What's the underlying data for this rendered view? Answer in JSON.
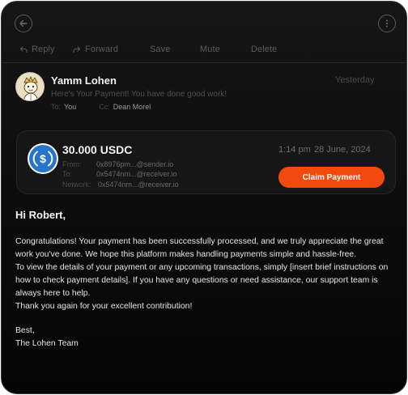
{
  "toolbar": {
    "reply": "Reply",
    "forward": "Forward",
    "save": "Save",
    "mute": "Mute",
    "delete": "Delete"
  },
  "message": {
    "sender": "Yamm Lohen",
    "subject": "Here's Your Payment! You have done good work!",
    "date": "Yesterday",
    "to_label": "To:",
    "to": "You",
    "cc_label": "Cc:",
    "cc": "Dean Morel"
  },
  "payment": {
    "amount": "30.000 USDC",
    "from_label": "From:",
    "from": "0x8976pm...@sender.io",
    "to_label": "To:",
    "to": "0x5474nm...@receiver.io",
    "network_label": "Network:",
    "network": "0x5474nm...@receiver.io",
    "time": "1:14 pm",
    "date": "28 June, 2024",
    "claim_label": "Claim Payment",
    "accent": "#f24a0d",
    "usdc_color": "#2775ca"
  },
  "body": {
    "greeting": "Hi Robert,",
    "lines": [
      "Congratulations! Your payment has been successfully processed, and we truly appreciate the great",
      "work you've done. We hope this platform makes handling payments simple and hassle-free.",
      "To view the details of your payment or any upcoming transactions, simply [insert brief instructions on",
      "how to check payment details]. If you have any questions or need assistance, our support team is",
      "always here to help.",
      "Thank you again for your excellent contribution!"
    ],
    "closing": "Best,",
    "signature": "The Lohen Team"
  },
  "icons": {
    "back": "arrow-left-icon",
    "more": "more-vertical-icon",
    "reply": "reply-icon",
    "forward": "forward-icon",
    "avatar": "avatar-illustration",
    "token": "usdc-icon"
  }
}
